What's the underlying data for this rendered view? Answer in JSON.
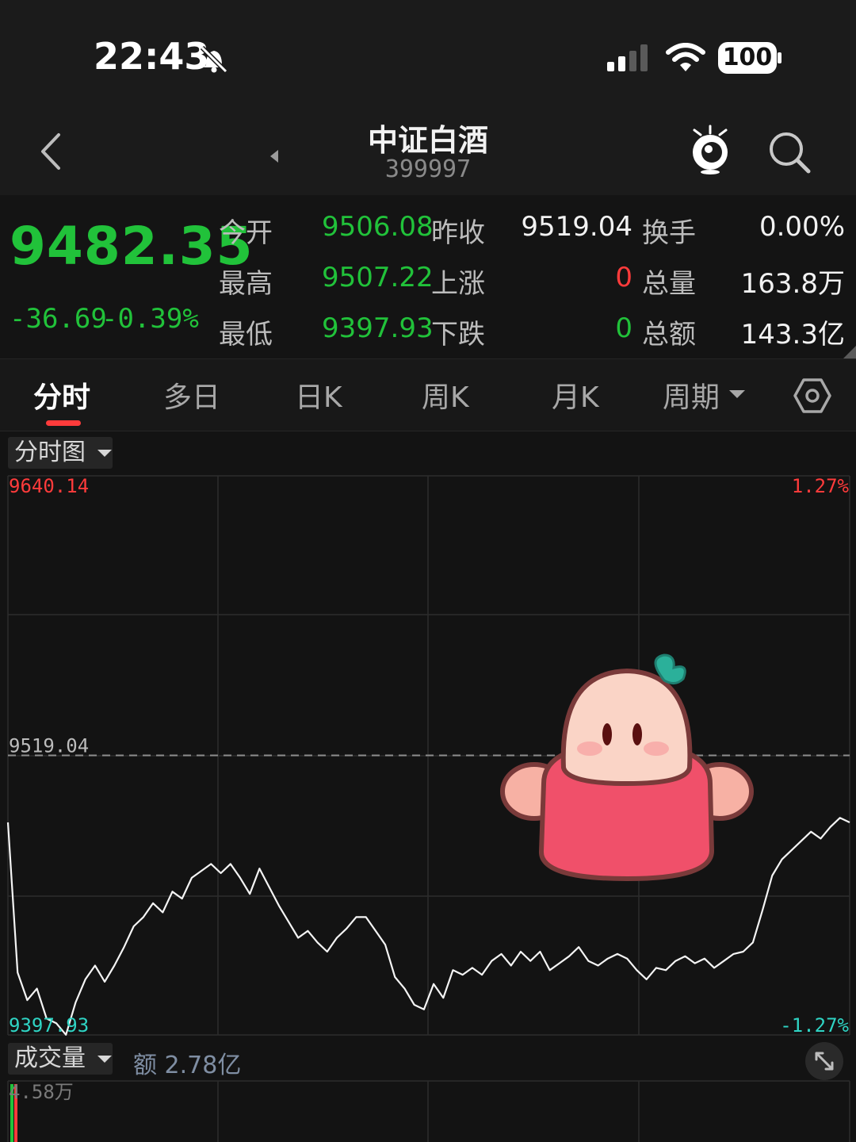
{
  "status_bar": {
    "time": "22:43",
    "battery": "100",
    "icons": [
      "bell-slash-icon",
      "signal-icon",
      "wifi-icon",
      "battery-icon"
    ]
  },
  "nav": {
    "title": "中证白酒",
    "code": "399997",
    "icons": [
      "back-chevron-icon",
      "collapse-arrow-icon",
      "mascot-eye-icon",
      "search-icon"
    ]
  },
  "quote": {
    "price": "9482.35",
    "change": "-36.69",
    "change_pct": "-0.39%",
    "rows": [
      {
        "l1": "今开",
        "v1": "9506.08",
        "l2": "昨收",
        "v2": "9519.04",
        "l3": "换手",
        "v3": "0.00%"
      },
      {
        "l1": "最高",
        "v1": "9507.22",
        "l2": "上涨",
        "v2": "0",
        "l3": "总量",
        "v3": "163.8万"
      },
      {
        "l1": "最低",
        "v1": "9397.93",
        "l2": "下跌",
        "v2": "0",
        "l3": "总额",
        "v3": "143.3亿"
      }
    ],
    "colors": {
      "up": "#ff3b3b",
      "down": "#21c23a",
      "neutral": "#f2f2f2"
    }
  },
  "tabs": [
    {
      "label": "分时",
      "active": true
    },
    {
      "label": "多日"
    },
    {
      "label": "日K"
    },
    {
      "label": "周K"
    },
    {
      "label": "月K"
    },
    {
      "label": "周期"
    }
  ],
  "chart_panel": {
    "selector_label": "分时图",
    "volume_selector_label": "成交量",
    "volume_amount": "额 2.78亿",
    "volume_max_label": "4.58万",
    "settings_icon": "hexagon-settings-icon",
    "expand_icon": "expand-arrows-icon"
  },
  "chart_data": {
    "type": "line",
    "y_high_label": "9640.14",
    "y_mid_label": "9519.04",
    "y_low_label": "9397.93",
    "pct_high_label": "1.27%",
    "pct_low_label": "-1.27%",
    "ylim": [
      9397.93,
      9640.14
    ],
    "reference": 9519.04,
    "grid": true,
    "series": [
      {
        "values": [
          9490,
          9425,
          9413,
          9418,
          9405,
          9403,
          9398,
          9412,
          9422,
          9428,
          9421,
          9428,
          9436,
          9445,
          9449,
          9455,
          9451,
          9460,
          9457,
          9466,
          9469,
          9472,
          9468,
          9472,
          9466,
          9459,
          9470,
          9462,
          9454,
          9447,
          9440,
          9443,
          9438,
          9434,
          9440,
          9444,
          9449,
          9449,
          9443,
          9437,
          9423,
          9418,
          9411,
          9409,
          9420,
          9414,
          9426,
          9424,
          9427,
          9424,
          9430,
          9433,
          9428,
          9434,
          9430,
          9434,
          9426,
          9429,
          9432,
          9436,
          9430,
          9428,
          9431,
          9433,
          9431,
          9426,
          9422,
          9427,
          9426,
          9430,
          9432,
          9429,
          9431,
          9427,
          9430,
          9433,
          9434,
          9438,
          9452,
          9467,
          9474,
          9478,
          9482,
          9486,
          9483,
          9488,
          9492,
          9490
        ]
      }
    ]
  },
  "mascot": {
    "icon": "mascot-sticker-icon"
  }
}
